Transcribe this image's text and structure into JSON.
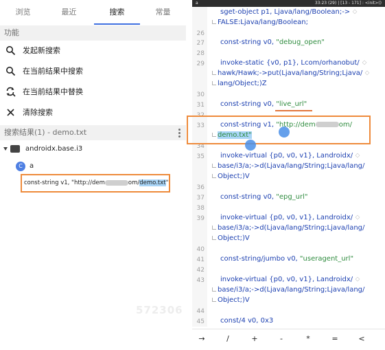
{
  "left_panel": {
    "tabs": [
      {
        "label": "浏览"
      },
      {
        "label": "最近"
      },
      {
        "label": "搜索"
      },
      {
        "label": "常量"
      }
    ],
    "active_tab": "搜索",
    "function_section": {
      "title": "功能"
    },
    "menu": [
      {
        "icon": "search-icon",
        "label": "发起新搜索"
      },
      {
        "icon": "search-icon",
        "label": "在当前结果中搜索"
      },
      {
        "icon": "replace-icon",
        "label": "在当前结果中替换"
      },
      {
        "icon": "close-icon",
        "label": "清除搜索"
      }
    ],
    "results_section": {
      "title": "搜索结果(1) - demo.txt"
    },
    "tree": {
      "package": "androidx.base.i3",
      "class_badge": "C",
      "class_name": "a",
      "result_prefix": "const-string v1, \"http://dem",
      "result_mid": "om/",
      "result_highlight": "demo.txt",
      "result_suffix": "\""
    },
    "watermark": "572306"
  },
  "right_panel": {
    "status": {
      "left": "a",
      "right": "33:23 (29) | [13 - 171] : <init>()"
    },
    "lines": {
      "l0": "sget-object p1, Ljava/lang/Boolean;->",
      "l0b": "FALSE:Ljava/lang/Boolean;",
      "l26": "26",
      "l27": "27",
      "c27a": "const-string v0, ",
      "c27b": "\"debug_open\"",
      "l28": "28",
      "l29": "29",
      "c29": "invoke-static {v0, p1}, Lcom/orhanobut/",
      "c29b": "hawk/Hawk;->put(Ljava/lang/String;Ljava/",
      "c29c": "lang/Object;)Z",
      "l30": "30",
      "l31": "31",
      "c31a": "const-string v0, ",
      "c31b": "\"live_url\"",
      "l32": "32",
      "l33": "33",
      "c33a": "const-string v1, ",
      "c33b": "\"http://dem",
      "c33c": "om/",
      "c33d": "demo.txt\"",
      "l34": "34",
      "l35": "35",
      "c35": "invoke-virtual {p0, v0, v1}, Landroidx/",
      "c35b": "base/i3/a;->d(Ljava/lang/String;Ljava/lang/",
      "c35c": "Object;)V",
      "l36": "36",
      "l37": "37",
      "c37a": "const-string v0, ",
      "c37b": "\"epg_url\"",
      "l38": "38",
      "l39": "39",
      "c39": "invoke-virtual {p0, v0, v1}, Landroidx/",
      "c39b": "base/i3/a;->d(Ljava/lang/String;Ljava/lang/",
      "c39c": "Object;)V",
      "l40": "40",
      "l41": "41",
      "c41a": "const-string/jumbo v0, ",
      "c41b": "\"useragent_url\"",
      "l42": "42",
      "l43": "43",
      "c43": "invoke-virtual {p0, v0, v1}, Landroidx/",
      "c43b": "base/i3/a;->d(Ljava/lang/String;Ljava/lang/",
      "c43c": "Object;)V",
      "l44": "44",
      "l45": "45",
      "c45": "const/4 v0, 0x3",
      "l46": "46"
    },
    "toolbar": [
      "→",
      "/",
      "+",
      "-",
      "*",
      "=",
      "<"
    ]
  },
  "colors": {
    "accent_blue": "#3f6fe0",
    "annotation_orange": "#ee8a3a",
    "code_blue": "#1b3fb0",
    "string_green": "#2e8b3e",
    "selection": "#a9d5f7"
  }
}
